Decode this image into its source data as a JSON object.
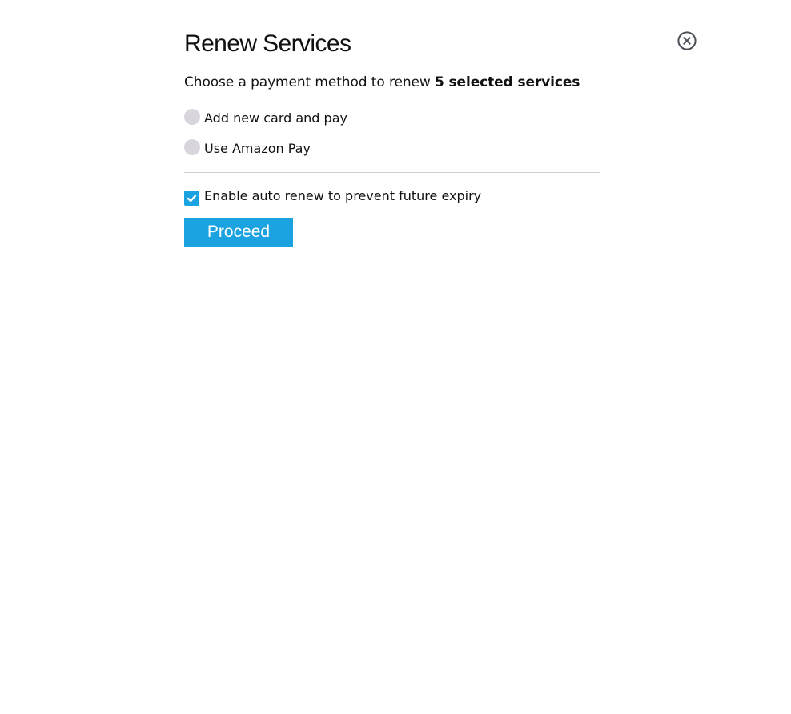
{
  "dialog": {
    "title": "Renew Services",
    "subtitle_prefix": "Choose a payment method to renew ",
    "subtitle_emphasis": "5 selected services"
  },
  "payment_options": [
    {
      "label": "Add new card and pay",
      "selected": false
    },
    {
      "label": "Use Amazon Pay",
      "selected": false
    }
  ],
  "auto_renew": {
    "label": "Enable auto renew to prevent future expiry",
    "checked": true
  },
  "actions": {
    "proceed_label": "Proceed"
  },
  "icons": {
    "close": "close-circle-icon",
    "check": "checkmark-icon"
  },
  "colors": {
    "accent": "#1aa3e0",
    "radio_unselected": "#d8d6dc",
    "divider": "#cfcfcf",
    "close_icon": "#4a4f55"
  }
}
